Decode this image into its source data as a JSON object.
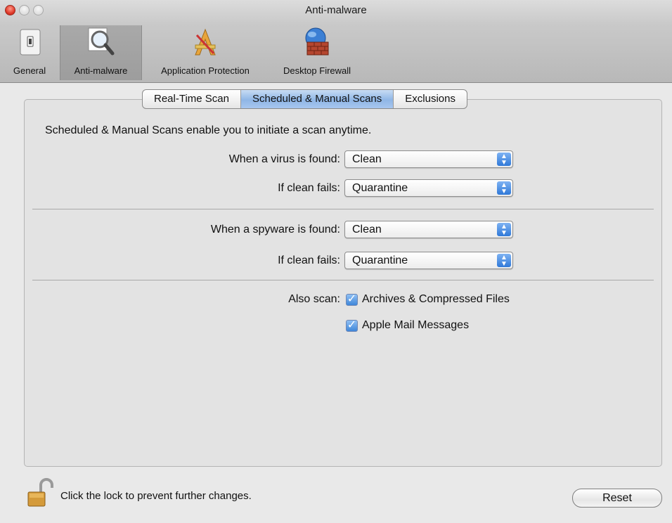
{
  "window": {
    "title": "Anti-malware"
  },
  "toolbar": {
    "items": [
      {
        "label": "General",
        "icon": "switch-icon"
      },
      {
        "label": "Anti-malware",
        "icon": "magnifier-icon"
      },
      {
        "label": "Application Protection",
        "icon": "app-protection-icon"
      },
      {
        "label": "Desktop Firewall",
        "icon": "globe-firewall-icon"
      }
    ],
    "selected": "Anti-malware"
  },
  "tabs": {
    "items": [
      "Real-Time Scan",
      "Scheduled & Manual Scans",
      "Exclusions"
    ],
    "active": "Scheduled & Manual Scans"
  },
  "content": {
    "intro": "Scheduled & Manual Scans enable you to initiate a scan anytime.",
    "virus_label": "When a virus is found:",
    "virus_value": "Clean",
    "virus_fail_label": "If clean fails:",
    "virus_fail_value": "Quarantine",
    "spyware_label": "When a spyware is found:",
    "spyware_value": "Clean",
    "spyware_fail_label": "If clean fails:",
    "spyware_fail_value": "Quarantine",
    "also_scan_label": "Also scan:",
    "archives_label": "Archives & Compressed Files",
    "archives_checked": true,
    "mail_label": "Apple Mail Messages",
    "mail_checked": true
  },
  "footer": {
    "lock_text": "Click the lock to prevent further changes.",
    "reset_label": "Reset"
  },
  "colors": {
    "accent": "#3f86d9",
    "close_button": "#e03a2a"
  }
}
